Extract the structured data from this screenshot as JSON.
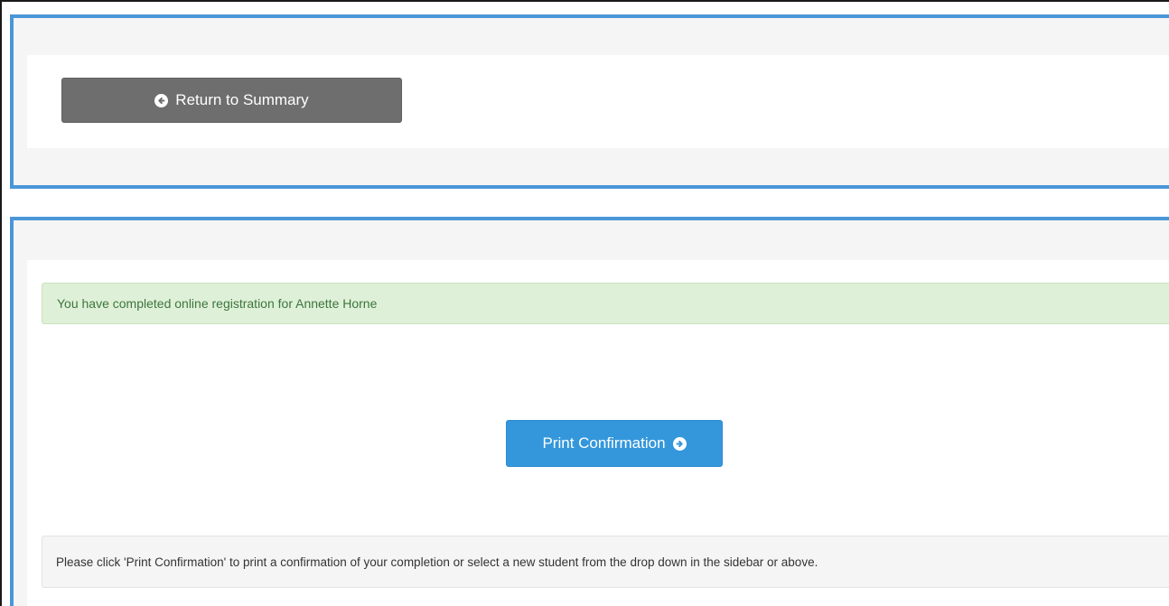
{
  "return_button": {
    "label": "Return to Summary",
    "icon": "arrow-circle-left-icon"
  },
  "alert": {
    "message": "You have completed online registration for Annette Horne"
  },
  "print_button": {
    "label": "Print Confirmation",
    "icon": "arrow-circle-right-icon"
  },
  "instructions": {
    "text": "Please click 'Print Confirmation' to print a confirmation of your completion or select a new student from the drop down in the sidebar or above."
  },
  "colors": {
    "panel_border": "#4a97d8",
    "return_button_bg": "#6e6e6e",
    "print_button_bg": "#3497dc",
    "alert_bg": "#dff0d8",
    "alert_text": "#3c763d"
  }
}
